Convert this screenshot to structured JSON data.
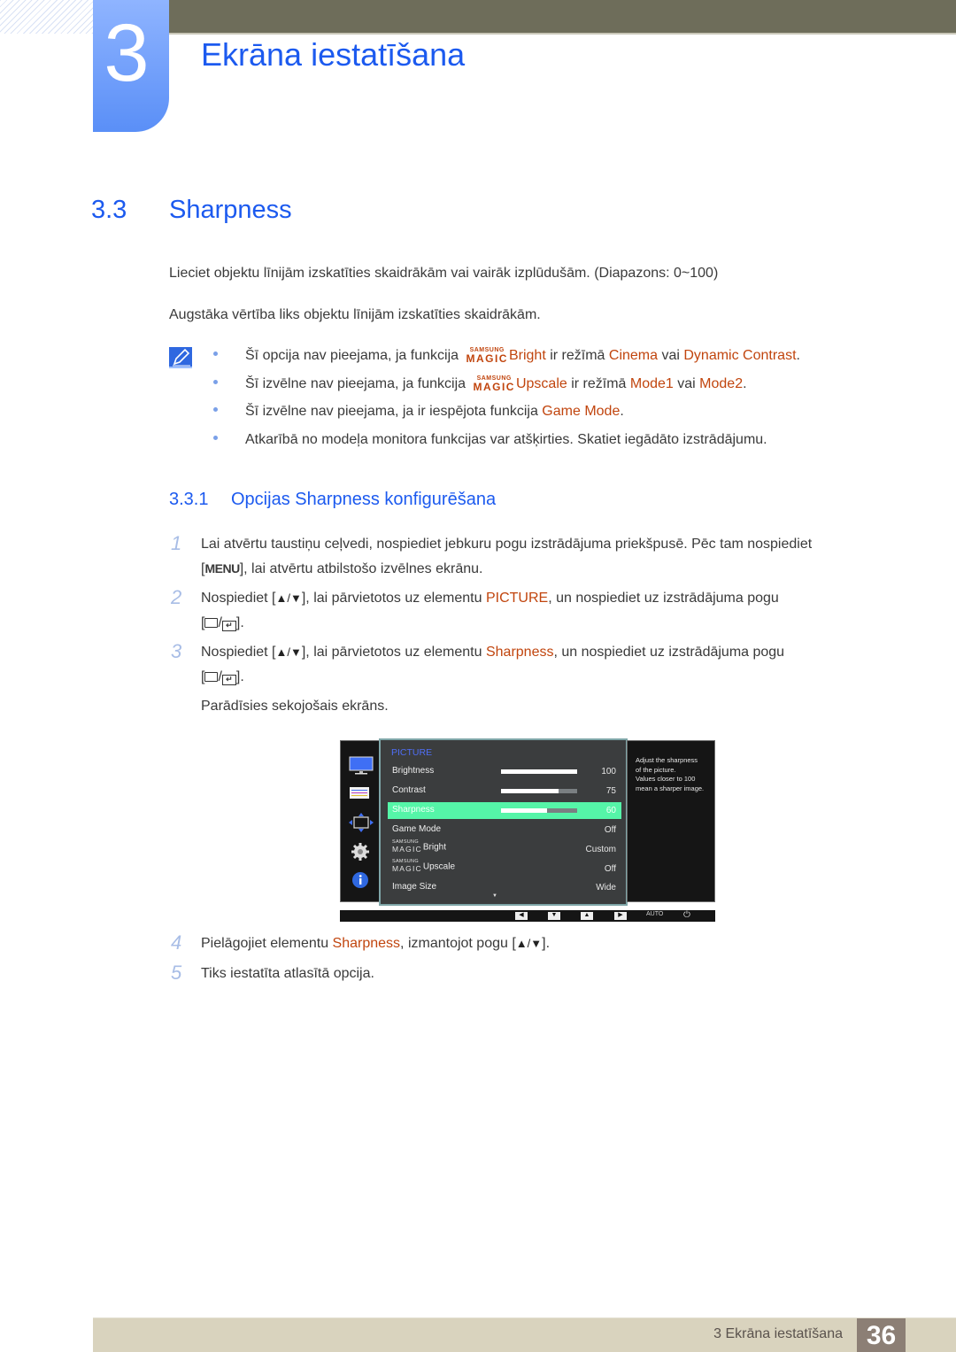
{
  "header": {
    "chapter_number": "3",
    "chapter_title": "Ekrāna iestatīšana"
  },
  "section": {
    "number": "3.3",
    "title": "Sharpness",
    "paragraphs": [
      "Lieciet objektu līnijām izskatīties skaidrākām vai vairāk izplūdušām. (Diapazons: 0~100)",
      "Augstāka vērtība liks objektu līnijām izskatīties skaidrākām."
    ]
  },
  "notes": {
    "icon": "note-pencil-icon",
    "magic_small": "SAMSUNG",
    "magic_big": "MAGIC",
    "items": [
      {
        "pre": "Šī opcija nav pieejama, ja funkcija ",
        "magic_word": "Bright",
        "mid": " ir režīmā ",
        "hl1": "Cinema",
        "conj": " vai ",
        "hl2": "Dynamic Contrast",
        "post": "."
      },
      {
        "pre": "Šī izvēlne nav pieejama, ja funkcija ",
        "magic_word": "Upscale",
        "mid": " ir režīmā ",
        "hl1": "Mode1",
        "conj": " vai ",
        "hl2": "Mode2",
        "post": "."
      },
      {
        "pre": "Šī izvēlne nav pieejama, ja ir iespējota funkcija ",
        "hl1": "Game Mode",
        "post": "."
      },
      {
        "pre": "Atkarībā no modeļa monitora funkcijas var atšķirties. Skatiet iegādāto izstrādājumu."
      }
    ]
  },
  "subsection": {
    "number": "3.3.1",
    "title": "Opcijas Sharpness konfigurēšana"
  },
  "steps": [
    {
      "num": "1",
      "line1": "Lai atvērtu taustiņu ceļvedi, nospiediet jebkuru pogu izstrādājuma priekšpusē. Pēc tam nospiediet",
      "key": "MENU",
      "line2_post": "], lai atvērtu atbilstošo izvēlnes ekrānu."
    },
    {
      "num": "2",
      "pre": "Nospiediet [",
      "keys": "▲/▼",
      "mid": "], lai pārvietotos uz elementu ",
      "hl": "PICTURE",
      "post": ", un nospiediet uz izstrādājuma pogu"
    },
    {
      "num": "3",
      "pre": "Nospiediet [",
      "keys": "▲/▼",
      "mid": "], lai pārvietotos uz elementu ",
      "hl": "Sharpness",
      "post": ", un nospiediet uz izstrādājuma pogu",
      "after": "Parādīsies sekojošais ekrāns."
    },
    {
      "num": "4",
      "pre": "Pielāgojiet elementu ",
      "hl": "Sharpness",
      "mid": ", izmantojot pogu [",
      "keys": "▲/▼",
      "post": "]."
    },
    {
      "num": "5",
      "pre": "Tiks iestatīta atlasītā opcija."
    }
  ],
  "osd": {
    "sidebar_icons": [
      "monitor-icon",
      "settings-list-icon",
      "resize-arrows-icon",
      "gear-icon",
      "info-icon"
    ],
    "heading": "PICTURE",
    "heading_color": "#4f6ef5",
    "selected_color": "#55f5a8",
    "rows": [
      {
        "label": "Brightness",
        "value": "100",
        "slider": 100
      },
      {
        "label": "Contrast",
        "value": "75",
        "slider": 75
      },
      {
        "label": "Sharpness",
        "value": "60",
        "slider": 60,
        "selected": true
      },
      {
        "label": "Game Mode",
        "value": "Off"
      },
      {
        "label": "Bright",
        "magic": true,
        "value": "Custom"
      },
      {
        "label": "Upscale",
        "magic": true,
        "value": "Off"
      },
      {
        "label": "Image Size",
        "value": "Wide"
      }
    ],
    "help_lines": [
      "Adjust the sharpness",
      "of the picture.",
      "Values closer to 100",
      "mean a sharper image."
    ],
    "bottom_buttons": [
      {
        "name": "left-arrow-button",
        "glyph": "◀"
      },
      {
        "name": "down-arrow-button",
        "glyph": "▼"
      },
      {
        "name": "up-arrow-button",
        "glyph": "▲"
      },
      {
        "name": "right-arrow-button",
        "glyph": "▶"
      }
    ],
    "auto_label": "AUTO",
    "power_glyph": "⏻",
    "more_glyph": "▼"
  },
  "footer": {
    "text": "3 Ekrāna iestatīšana",
    "page": "36"
  }
}
